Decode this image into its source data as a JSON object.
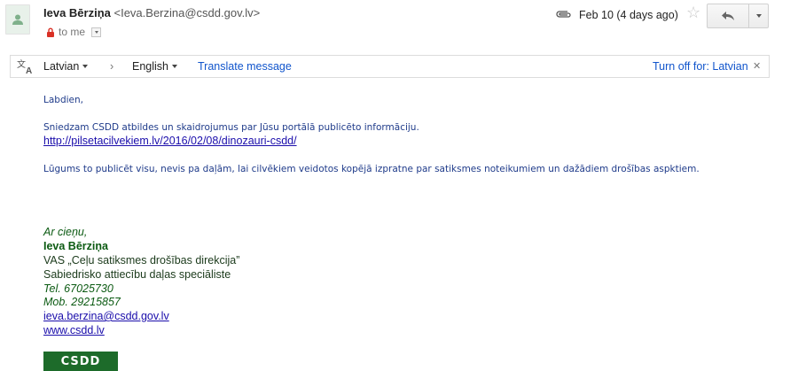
{
  "header": {
    "sender_name": "Ieva Bērziņa",
    "sender_email": "<Ieva.Berzina@csdd.gov.lv>",
    "recipient_label": "to me",
    "date": "Feb 10 (4 days ago)",
    "icons": {
      "avatar": "person-icon",
      "lock": "lock-icon",
      "attachment": "paperclip-icon",
      "star": "star-icon",
      "reply": "reply-icon",
      "more": "chevron-down-icon"
    }
  },
  "translate_bar": {
    "source_language": "Latvian",
    "arrow": "›",
    "target_language": "English",
    "translate_link": "Translate message",
    "turn_off_label": "Turn off for: Latvian",
    "close_symbol": "✕"
  },
  "message": {
    "greeting": "Labdien,",
    "line1": "Sniedzam CSDD atbildes un skaidrojumus par Jūsu portālā publicēto informāciju.",
    "link": "http://pilsetacilvekiem.lv/2016/02/08/dinozauri-csdd/",
    "line2": "Lūgums to publicēt visu, nevis pa daļām, lai cilvēkiem veidotos kopējā izpratne par satiksmes noteikumiem un dažādiem drošības aspktiem."
  },
  "signature": {
    "closing": "Ar cieņu,",
    "name": "Ieva Bērziņa",
    "org": "VAS „Ceļu satiksmes drošības direkcija”",
    "title": "Sabiedrisko attiecību daļas speciāliste",
    "tel": "Tel. 67025730",
    "mob": "Mob. 29215857",
    "email": "ieva.berzina@csdd.gov.lv",
    "website": "www.csdd.lv",
    "logo_text": "CSDD"
  },
  "colors": {
    "link": "#1155cc",
    "body_text": "#1f3b8a",
    "signature_green": "#0b5a12",
    "logo_bg": "#1d6b2a"
  }
}
